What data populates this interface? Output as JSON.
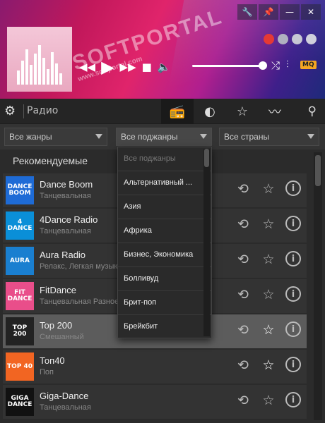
{
  "window": {
    "pin_icon": "pin-icon",
    "minimize_label": "—",
    "close_label": "✕"
  },
  "watermark": {
    "text": "SOFTPORTAL",
    "sub": "www.softportal.com"
  },
  "player": {
    "mq_label": "MQ"
  },
  "toolbar": {
    "section_label": "Радио"
  },
  "filters": {
    "genre": "Все жанры",
    "subgenre": "Все поджанры",
    "country": "Все страны"
  },
  "list": {
    "title": "Рекомендуемые",
    "stations": [
      {
        "name": "Dance Boom",
        "sub": "Танцевальная",
        "logo_text": "DANCE BOOM",
        "logo_color": "#1e6bd6"
      },
      {
        "name": "4Dance Radio",
        "sub": "Танцевальная",
        "logo_text": "4 DANCE",
        "logo_color": "#0a8fd8"
      },
      {
        "name": "Aura Radio",
        "sub": "Релакс, Легкая музыка",
        "logo_text": "AURA",
        "logo_color": "#1a7fd0"
      },
      {
        "name": "FitDance",
        "sub": "Танцевальная Разное",
        "logo_text": "FIT DANCE",
        "logo_color": "#e94e8a"
      },
      {
        "name": "Top 200",
        "sub": "Смешанный",
        "logo_text": "TOP 200",
        "logo_color": "#222222"
      },
      {
        "name": "Топ40",
        "sub": "Поп",
        "logo_text": "TOP 40",
        "logo_color": "#f26522"
      },
      {
        "name": "Giga-Dance",
        "sub": "Танцевальная",
        "logo_text": "GIGA DANCE",
        "logo_color": "#111111"
      }
    ]
  },
  "dropdown": {
    "items": [
      "Все поджанры",
      "Альтернативный ...",
      "Азия",
      "Африка",
      "Бизнес, Экономика",
      "Болливуд",
      "Брит-поп",
      "Брейкбит"
    ]
  }
}
